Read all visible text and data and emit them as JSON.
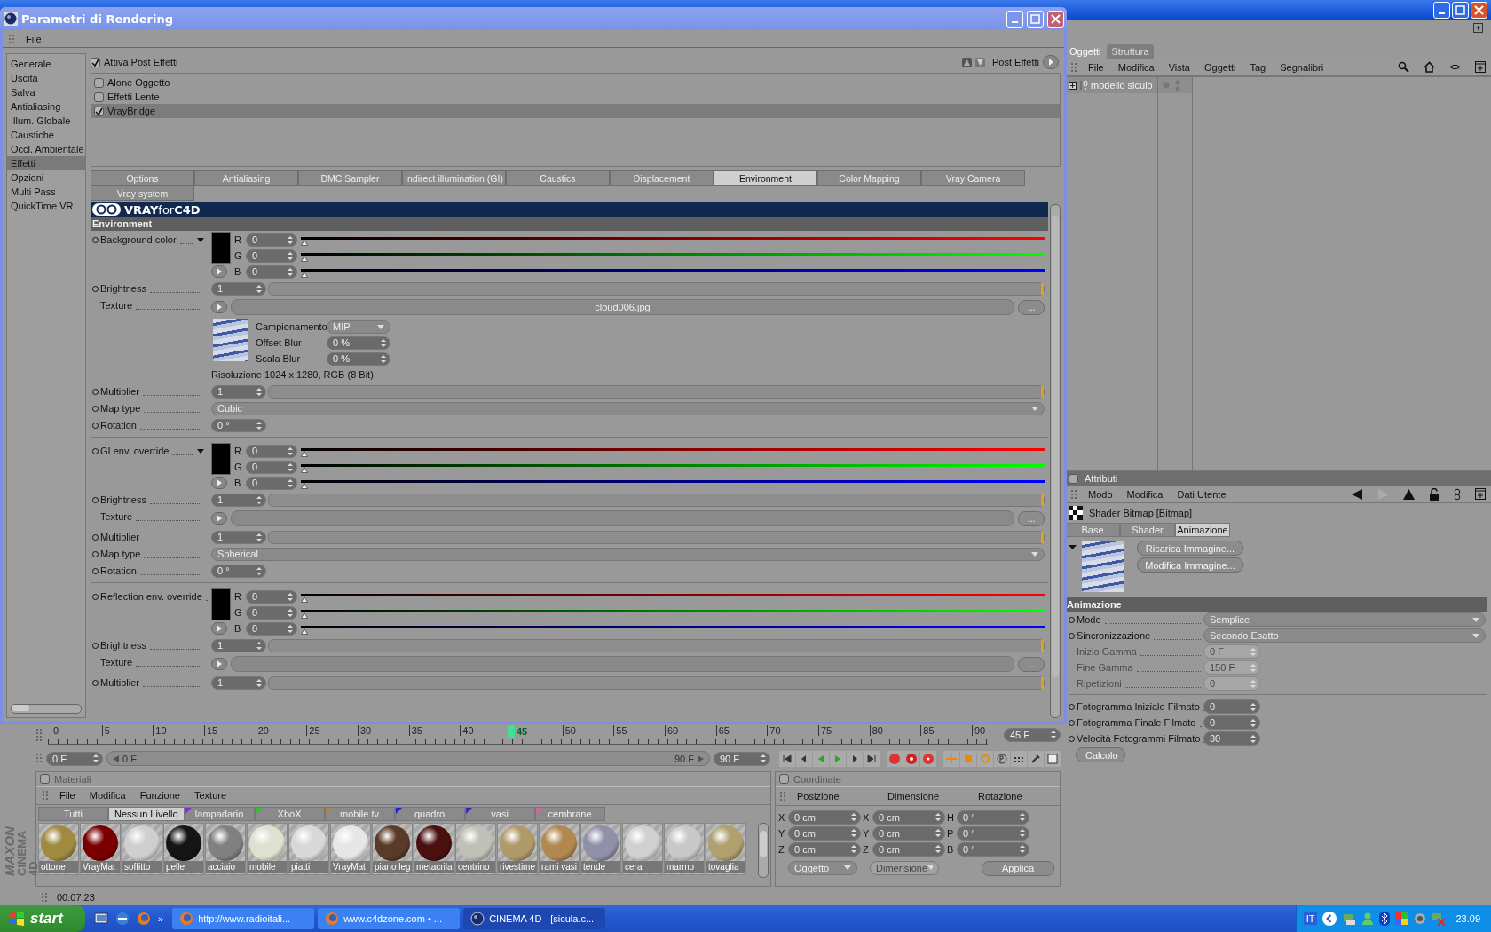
{
  "dialog": {
    "title": "Parametri di Rendering",
    "menu": [
      "File"
    ],
    "sidebar": [
      {
        "label": "Generale",
        "selected": false
      },
      {
        "label": "Uscita",
        "selected": false
      },
      {
        "label": "Salva",
        "selected": false
      },
      {
        "label": "Antialiasing",
        "selected": false
      },
      {
        "label": "Illum. Globale",
        "selected": false
      },
      {
        "label": "Caustiche",
        "selected": false
      },
      {
        "label": "Occl. Ambientale",
        "selected": false
      },
      {
        "label": "Effetti",
        "selected": true
      },
      {
        "label": "Opzioni",
        "selected": false
      },
      {
        "label": "Multi Pass",
        "selected": false
      },
      {
        "label": "QuickTime VR",
        "selected": false
      }
    ],
    "post_effects": {
      "label": "Attiva Post Effetti",
      "checked": true,
      "menu_label": "Post Effetti",
      "items": [
        {
          "label": "Alone Oggetto",
          "checked": false,
          "selected": false
        },
        {
          "label": "Effetti Lente",
          "checked": false,
          "selected": false
        },
        {
          "label": "VrayBridge",
          "checked": true,
          "selected": true
        }
      ]
    },
    "tabs": [
      {
        "label": "Options",
        "selected": false
      },
      {
        "label": "Antialiasing",
        "selected": false
      },
      {
        "label": "DMC Sampler",
        "selected": false
      },
      {
        "label": "Indirect illumination (GI)",
        "selected": false
      },
      {
        "label": "Caustics",
        "selected": false
      },
      {
        "label": "Displacement",
        "selected": false
      },
      {
        "label": "Environment",
        "selected": true
      },
      {
        "label": "Color Mapping",
        "selected": false
      },
      {
        "label": "Vray Camera",
        "selected": false
      },
      {
        "label": "Vray system",
        "selected": false
      }
    ],
    "banner": "**VRAY**for**C4D**",
    "section": "Environment",
    "rows": [
      {
        "kind": "color",
        "label": "Background color",
        "animatable": true,
        "channels": [
          {
            "name": "R",
            "value": "0",
            "level": 0
          },
          {
            "name": "G",
            "value": "0",
            "level": 0
          },
          {
            "name": "B",
            "value": "0",
            "level": 0
          }
        ]
      },
      {
        "kind": "slider",
        "label": "Brightness",
        "animatable": true,
        "value": "1",
        "level": 1
      },
      {
        "kind": "texture",
        "label": "Texture",
        "animatable": false,
        "file": "cloud006.jpg",
        "browse": "...",
        "preview": {
          "fields": [
            {
              "kind": "dropdown",
              "label": "Campionamento",
              "value": "MIP"
            },
            {
              "kind": "number",
              "label": "Offset Blur",
              "value": "0 %"
            },
            {
              "kind": "number",
              "label": "Scala Blur",
              "value": "0 %"
            }
          ],
          "info": "Risoluzione 1024 x 1280, RGB (8 Bit)"
        }
      },
      {
        "kind": "slider",
        "label": "Multiplier",
        "animatable": true,
        "value": "1",
        "level": 1
      },
      {
        "kind": "dropdown",
        "label": "Map type",
        "animatable": true,
        "value": "Cubic"
      },
      {
        "kind": "number",
        "label": "Rotation",
        "animatable": true,
        "value": "0 °"
      },
      {
        "kind": "divider"
      },
      {
        "kind": "color",
        "label": "GI env. override",
        "animatable": true,
        "channels": [
          {
            "name": "R",
            "value": "0",
            "level": 0
          },
          {
            "name": "G",
            "value": "0",
            "level": 0
          },
          {
            "name": "B",
            "value": "0",
            "level": 0
          }
        ]
      },
      {
        "kind": "slider",
        "label": "Brightness",
        "animatable": true,
        "value": "1",
        "level": 1
      },
      {
        "kind": "texture",
        "label": "Texture",
        "animatable": false,
        "browse": "..."
      },
      {
        "kind": "slider",
        "label": "Multiplier",
        "animatable": true,
        "value": "1",
        "level": 1
      },
      {
        "kind": "dropdown",
        "label": "Map type",
        "animatable": true,
        "value": "Spherical"
      },
      {
        "kind": "number",
        "label": "Rotation",
        "animatable": true,
        "value": "0 °"
      },
      {
        "kind": "divider"
      },
      {
        "kind": "color",
        "label": "Reflection env. override",
        "animatable": true,
        "channels": [
          {
            "name": "R",
            "value": "0",
            "level": 0
          },
          {
            "name": "G",
            "value": "0",
            "level": 0
          },
          {
            "name": "B",
            "value": "0",
            "level": 0
          }
        ]
      },
      {
        "kind": "slider",
        "label": "Brightness",
        "animatable": true,
        "value": "1",
        "level": 1
      },
      {
        "kind": "texture",
        "label": "Texture",
        "animatable": false,
        "browse": "..."
      },
      {
        "kind": "slider",
        "label": "Multiplier",
        "animatable": true,
        "value": "1",
        "level": 1
      }
    ]
  },
  "object_manager": {
    "tabs": [
      {
        "label": "Oggetti",
        "selected": true
      },
      {
        "label": "Struttura",
        "selected": false
      }
    ],
    "menu": [
      "File",
      "Modifica",
      "Vista",
      "Oggetti",
      "Tag",
      "Segnalibri"
    ],
    "objects": [
      {
        "name": "modello siculo",
        "expanded": false
      }
    ]
  },
  "attributes": {
    "title": "Attributi",
    "checked": false,
    "menu": [
      "Modo",
      "Modifica",
      "Dati Utente"
    ],
    "object": "Shader Bitmap [Bitmap]",
    "tabs": [
      {
        "label": "Base",
        "selected": false
      },
      {
        "label": "Shader",
        "selected": false
      },
      {
        "label": "Animazione",
        "selected": true
      }
    ],
    "buttons": [
      "Ricarica Immagine...",
      "Modifica Immagine..."
    ],
    "section": "Animazione",
    "fields": [
      {
        "kind": "dropdown",
        "label": "Modo",
        "value": "Semplice",
        "animatable": true,
        "disabled": false
      },
      {
        "kind": "dropdown",
        "label": "Sincronizzazione",
        "value": "Secondo Esatto",
        "animatable": true,
        "disabled": false
      },
      {
        "kind": "number",
        "label": "Inizio Gamma",
        "value": "0 F",
        "animatable": false,
        "disabled": true
      },
      {
        "kind": "number",
        "label": "Fine Gamma",
        "value": "150 F",
        "animatable": false,
        "disabled": true
      },
      {
        "kind": "number",
        "label": "Ripetizioni",
        "value": "0",
        "animatable": false,
        "disabled": true
      },
      {
        "kind": "divider"
      },
      {
        "kind": "number",
        "label": "Fotogramma Iniziale Filmato",
        "value": "0",
        "animatable": true,
        "disabled": false
      },
      {
        "kind": "number",
        "label": "Fotogramma Finale Filmato",
        "value": "0",
        "animatable": true,
        "disabled": false
      },
      {
        "kind": "number",
        "label": "Velocità Fotogrammi Filmato",
        "value": "30",
        "animatable": true,
        "disabled": false
      }
    ],
    "action": "Calcolo"
  },
  "timeline": {
    "ticks": [
      "0",
      "5",
      "10",
      "15",
      "20",
      "25",
      "30",
      "35",
      "40",
      "50",
      "55",
      "60",
      "65",
      "70",
      "75",
      "80",
      "85",
      "90"
    ],
    "playhead": {
      "label": "45",
      "level": 0.5
    },
    "current": "45 F",
    "start": "0 F",
    "range": {
      "start": "0 F",
      "end": "90 F",
      "level": 1
    },
    "end": "90 F"
  },
  "materials": {
    "title": "Materiali",
    "checked": false,
    "menu": [
      "File",
      "Modifica",
      "Funzione",
      "Texture"
    ],
    "layers": [
      {
        "label": "Tutti",
        "selected": false
      },
      {
        "label": "Nessun Livello",
        "selected": true
      },
      {
        "label": "lampadario",
        "selected": false,
        "color": "#8a2be2"
      },
      {
        "label": "XboX",
        "selected": false,
        "color": "#22cc22"
      },
      {
        "label": "mobile tv",
        "selected": false,
        "color": "#b08040"
      },
      {
        "label": "quadro",
        "selected": false,
        "color": "#2020e0"
      },
      {
        "label": "vasi",
        "selected": false,
        "color": "#4020c0"
      },
      {
        "label": "cembrane",
        "selected": false,
        "color": "#e060a0"
      }
    ],
    "items": [
      {
        "name": "ottone",
        "color": "#a08a40"
      },
      {
        "name": "VrayMat",
        "color": "#7a0000"
      },
      {
        "name": "soffitto",
        "color": "#cfcfcf"
      },
      {
        "name": "pelle",
        "color": "#151515"
      },
      {
        "name": "acciaio",
        "color": "#808080"
      },
      {
        "name": "mobile",
        "color": "#e0e0d0"
      },
      {
        "name": "piatti",
        "color": "#d8d8d8"
      },
      {
        "name": "VrayMat",
        "color": "#e6e6e6"
      },
      {
        "name": "piano leg",
        "color": "#5a3a28"
      },
      {
        "name": "metacrila",
        "color": "#4a1010"
      },
      {
        "name": "centrino",
        "color": "#c0c0b8"
      },
      {
        "name": "rivestime",
        "color": "#b09a6a"
      },
      {
        "name": "rami vasi",
        "color": "#b08850"
      },
      {
        "name": "tende",
        "color": "#9090a8"
      },
      {
        "name": "cera",
        "color": "#d0d0d0"
      },
      {
        "name": "marmo",
        "color": "#c8c8c8"
      },
      {
        "name": "tovaglia",
        "color": "#b0a070"
      }
    ]
  },
  "coordinates": {
    "title": "Coordinate",
    "checked": false,
    "headers": [
      "Posizione",
      "Dimensione",
      "Rotazione"
    ],
    "rows": [
      [
        {
          "axis": "X",
          "value": "0 cm"
        },
        {
          "axis": "X",
          "value": "0 cm"
        },
        {
          "axis": "H",
          "value": "0 °"
        }
      ],
      [
        {
          "axis": "Y",
          "value": "0 cm"
        },
        {
          "axis": "Y",
          "value": "0 cm"
        },
        {
          "axis": "P",
          "value": "0 °"
        }
      ],
      [
        {
          "axis": "Z",
          "value": "0 cm"
        },
        {
          "axis": "Z",
          "value": "0 cm"
        },
        {
          "axis": "B",
          "value": "0 °"
        }
      ]
    ],
    "modes": [
      {
        "label": "Oggetto",
        "disabled": false
      },
      {
        "label": "Dimensione",
        "disabled": true
      }
    ],
    "apply": "Applica"
  },
  "status": {
    "time": "00:07:23"
  },
  "logo": {
    "brand": "MAXON",
    "product": "CINEMA 4D"
  },
  "taskbar": {
    "start": "start",
    "more": "»",
    "tasks": [
      {
        "label": "http://www.radioitali...",
        "kind": "browser",
        "selected": false
      },
      {
        "label": "www.c4dzone.com • ...",
        "kind": "browser",
        "selected": false
      },
      {
        "label": "CINEMA 4D - [sicula.c...",
        "kind": "c4d",
        "selected": true
      }
    ],
    "language": "IT",
    "clock": "23.09"
  }
}
